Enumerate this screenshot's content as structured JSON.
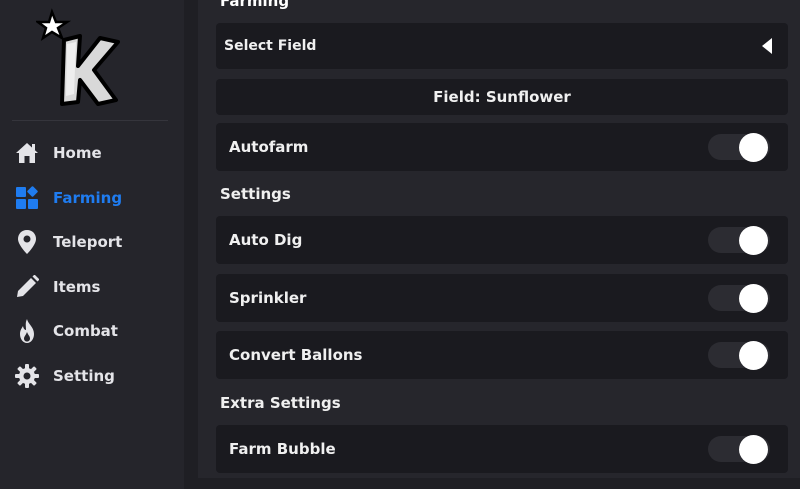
{
  "sidebar": {
    "logo_letter": "K",
    "items": [
      {
        "label": "Home",
        "icon": "home-icon",
        "active": false
      },
      {
        "label": "Farming",
        "icon": "farming-icon",
        "active": true
      },
      {
        "label": "Teleport",
        "icon": "location-pin-icon",
        "active": false
      },
      {
        "label": "Items",
        "icon": "pencil-icon",
        "active": false
      },
      {
        "label": "Combat",
        "icon": "flame-icon",
        "active": false
      },
      {
        "label": "Setting",
        "icon": "gear-icon",
        "active": false
      }
    ]
  },
  "main": {
    "top_section_label": "Farming",
    "select_field_label": "Select Field",
    "current_field": "Field: Sunflower",
    "autofarm": {
      "label": "Autofarm",
      "on": true
    },
    "settings_heading": "Settings",
    "settings": [
      {
        "label": "Auto Dig",
        "on": true
      },
      {
        "label": "Sprinkler",
        "on": true
      },
      {
        "label": "Convert Ballons",
        "on": true
      }
    ],
    "extra_heading": "Extra Settings",
    "extra": [
      {
        "label": "Farm Bubble",
        "on": true
      }
    ]
  },
  "colors": {
    "accent": "#1f7cf0",
    "background": "#1f1f24",
    "panel": "#26262c",
    "row": "#1a1a1f",
    "toggle_track": "#2c2c32"
  }
}
